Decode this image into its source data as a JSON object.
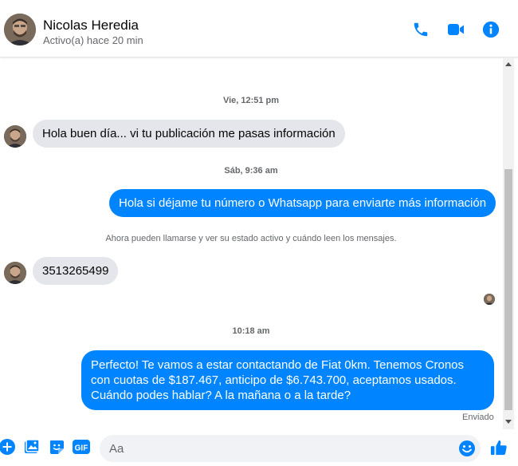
{
  "header": {
    "contact_name": "Nicolas Heredia",
    "status": "Activo(a) hace 20 min",
    "actions": [
      {
        "name": "phone-icon"
      },
      {
        "name": "video-icon"
      },
      {
        "name": "info-icon"
      }
    ]
  },
  "conversation": {
    "timestamps": [
      "Vie, 12:51 pm",
      "Sáb, 9:36 am",
      "10:18 am"
    ],
    "messages": [
      {
        "from": "contact",
        "text": "Hola buen día... vi tu publicación me pasas información"
      },
      {
        "from": "me",
        "text": "Hola si déjame tu número o Whatsapp para enviarte más información"
      },
      {
        "from": "contact",
        "text": "3513265499"
      },
      {
        "from": "me",
        "text": "Perfecto! Te vamos a estar contactando de Fiat 0km. Tenemos Cronos con cuotas de $187.467, anticipo de $6.743.700, aceptamos usados. Cuándo podes hablar? A la mañana o a la tarde?"
      }
    ],
    "system_notice": "Ahora pueden llamarse y ver su estado activo y cuándo leen los mensajes.",
    "delivery_status": "Enviado"
  },
  "composer": {
    "placeholder": "Aa",
    "value": "",
    "tools": [
      "plus-icon",
      "image-icon",
      "sticker-icon",
      "gif-icon"
    ],
    "gif_label": "GIF"
  },
  "colors": {
    "accent": "#0084ff",
    "incoming_bubble": "#e4e6eb",
    "secondary_text": "#65676b"
  }
}
